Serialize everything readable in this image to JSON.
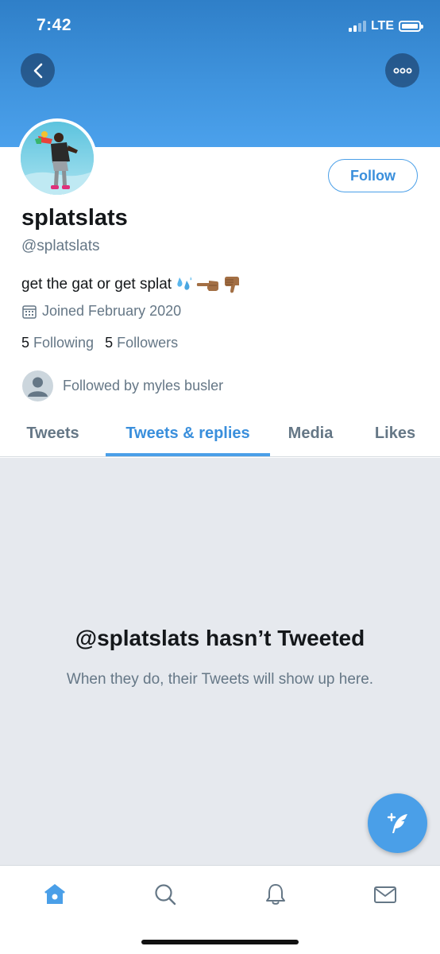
{
  "status_bar": {
    "time": "7:42",
    "network": "LTE"
  },
  "profile": {
    "display_name": "splatslats",
    "handle": "@splatslats",
    "bio_text": "get the gat or get splat",
    "joined": "Joined February 2020",
    "following_count": "5",
    "following_label": "Following",
    "followers_count": "5",
    "followers_label": "Followers",
    "followed_by": "Followed by myles busler"
  },
  "actions": {
    "follow_label": "Follow"
  },
  "tabs": [
    {
      "label": "Tweets"
    },
    {
      "label": "Tweets & replies"
    },
    {
      "label": "Media"
    },
    {
      "label": "Likes"
    }
  ],
  "active_tab": "Tweets & replies",
  "empty_state": {
    "title": "@splatslats hasn’t Tweeted",
    "subtitle": "When they do, their Tweets will show up here."
  },
  "bottom_nav": [
    {
      "icon": "home-icon",
      "active": true
    },
    {
      "icon": "search-icon",
      "active": false
    },
    {
      "icon": "bell-icon",
      "active": false
    },
    {
      "icon": "mail-icon",
      "active": false
    }
  ],
  "colors": {
    "accent": "#4a9fe8",
    "banner": "#3f93dd",
    "muted_text": "#657786",
    "empty_bg": "#e6e9ee"
  }
}
